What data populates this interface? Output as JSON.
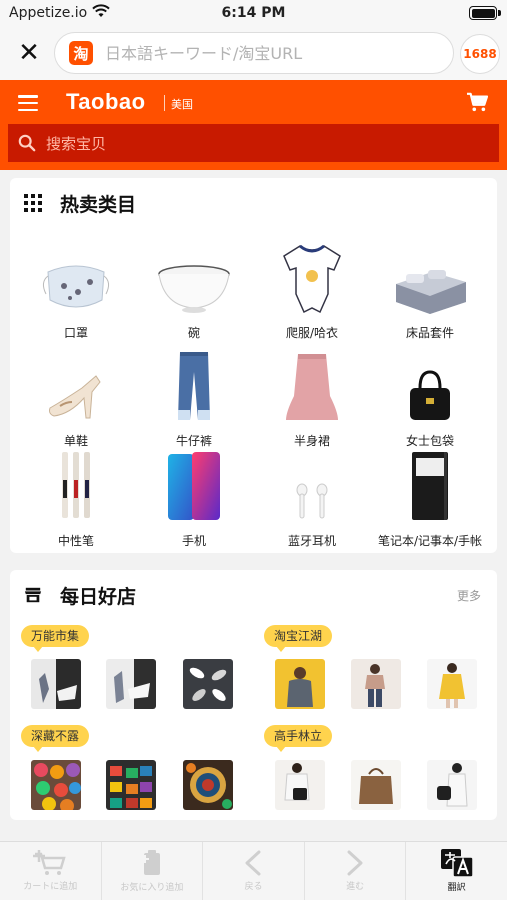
{
  "status_bar": {
    "carrier": "Appetize.io",
    "time": "6:14 PM"
  },
  "search_bar": {
    "placeholder": "日本語キーワード/淘宝URL",
    "logo_glyph": "淘",
    "btn_1688": "1688"
  },
  "header": {
    "title": "Taobao",
    "region": "美国",
    "search_placeholder": "搜索宝贝"
  },
  "hot_categories": {
    "title": "热卖类目",
    "items": [
      {
        "label": "口罩"
      },
      {
        "label": "碗"
      },
      {
        "label": "爬服/哈衣"
      },
      {
        "label": "床品套件"
      },
      {
        "label": "单鞋"
      },
      {
        "label": "牛仔裤"
      },
      {
        "label": "半身裙"
      },
      {
        "label": "女士包袋"
      },
      {
        "label": "中性笔"
      },
      {
        "label": "手机"
      },
      {
        "label": "蓝牙耳机"
      },
      {
        "label": "笔记本/记事本/手帐"
      }
    ]
  },
  "daily_shops": {
    "title": "每日好店",
    "more": "更多",
    "groups": [
      {
        "tag": "万能市集"
      },
      {
        "tag": "淘宝江湖"
      },
      {
        "tag": "深藏不露"
      },
      {
        "tag": "高手林立"
      }
    ]
  },
  "toolbar": {
    "items": [
      {
        "label": "カートに追加",
        "icon": "cart-plus-icon"
      },
      {
        "label": "お気に入り追加",
        "icon": "favorite-add-icon"
      },
      {
        "label": "戻る",
        "icon": "back-icon"
      },
      {
        "label": "進む",
        "icon": "forward-icon"
      },
      {
        "label": "翻訳",
        "icon": "translate-icon"
      }
    ]
  },
  "colors": {
    "brand_orange": "#ff5000",
    "search_red": "#c81a00",
    "tag_yellow": "#ffd34d"
  }
}
